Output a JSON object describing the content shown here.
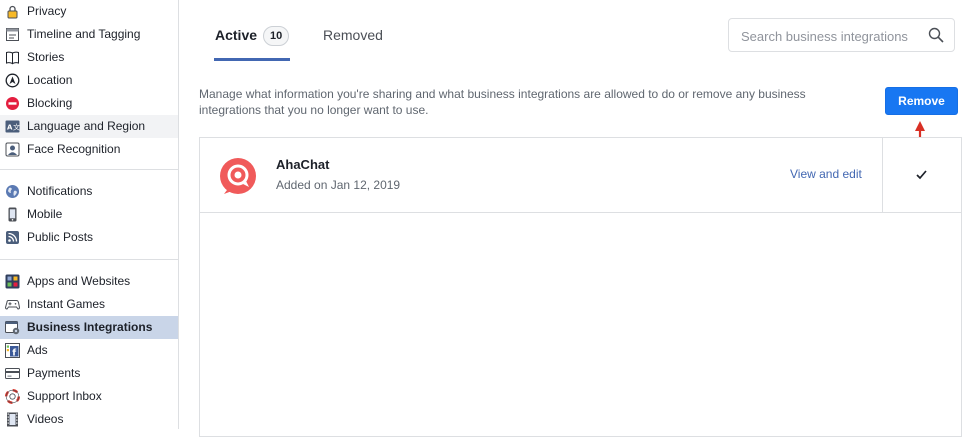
{
  "sidebar": {
    "group1": [
      {
        "label": "Privacy",
        "icon": "lock-icon"
      },
      {
        "label": "Timeline and Tagging",
        "icon": "timeline-icon"
      },
      {
        "label": "Stories",
        "icon": "book-icon"
      },
      {
        "label": "Location",
        "icon": "location-icon"
      },
      {
        "label": "Blocking",
        "icon": "blocking-icon"
      },
      {
        "label": "Language and Region",
        "icon": "language-icon"
      },
      {
        "label": "Face Recognition",
        "icon": "face-recognition-icon"
      }
    ],
    "group2": [
      {
        "label": "Notifications",
        "icon": "globe-icon"
      },
      {
        "label": "Mobile",
        "icon": "mobile-icon"
      },
      {
        "label": "Public Posts",
        "icon": "rss-icon"
      }
    ],
    "group3": [
      {
        "label": "Apps and Websites",
        "icon": "apps-icon"
      },
      {
        "label": "Instant Games",
        "icon": "gamepad-icon"
      },
      {
        "label": "Business Integrations",
        "icon": "business-integrations-icon"
      },
      {
        "label": "Ads",
        "icon": "ads-icon"
      },
      {
        "label": "Payments",
        "icon": "payments-icon"
      },
      {
        "label": "Support Inbox",
        "icon": "lifebuoy-icon"
      },
      {
        "label": "Videos",
        "icon": "film-icon"
      }
    ]
  },
  "tabs": {
    "active_label": "Active",
    "active_count": "10",
    "removed_label": "Removed"
  },
  "search": {
    "placeholder": "Search business integrations"
  },
  "description": "Manage what information you're sharing and what business integrations are allowed to do or remove any business integrations that you no longer want to use.",
  "remove_button": "Remove",
  "integrations": [
    {
      "name": "AhaChat",
      "added": "Added on Jan 12, 2019",
      "action": "View and edit",
      "checked": true,
      "logo_color": "#f05a5a"
    }
  ],
  "colors": {
    "accent": "#1877f2",
    "link": "#4267b2",
    "selected_bg": "#c9d5e8",
    "arrow": "#d93025"
  }
}
